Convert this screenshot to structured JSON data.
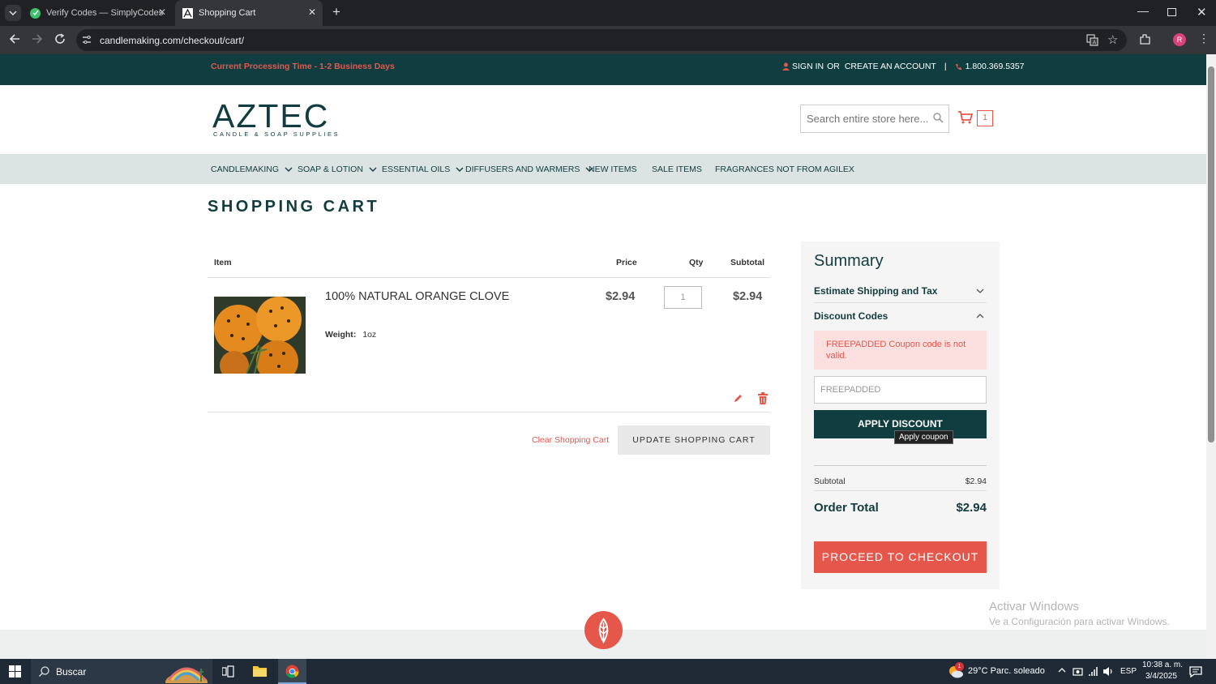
{
  "browser": {
    "tabs": [
      {
        "title": "Verify Codes — SimplyCodes",
        "active": false
      },
      {
        "title": "Shopping Cart",
        "active": true
      }
    ],
    "url": "candlemaking.com/checkout/cart/",
    "profile_initial": "R"
  },
  "site": {
    "processing_notice": "Current Processing Time - 1-2 Business Days",
    "sign_in": "SIGN IN",
    "or": "OR",
    "create_account": "CREATE AN ACCOUNT",
    "separator": "|",
    "phone": "1.800.369.5357",
    "logo_main": "AZTEC",
    "logo_sub": "CANDLE & SOAP SUPPLIES",
    "search_placeholder": "Search entire store here...",
    "cart_count": "1",
    "nav": [
      {
        "label": "CANDLEMAKING",
        "dropdown": true
      },
      {
        "label": "SOAP & LOTION",
        "dropdown": true
      },
      {
        "label": "ESSENTIAL OILS",
        "dropdown": true
      },
      {
        "label": "DIFFUSERS AND WARMERS",
        "dropdown": true
      },
      {
        "label": "NEW ITEMS",
        "dropdown": false
      },
      {
        "label": "SALE ITEMS",
        "dropdown": false
      },
      {
        "label": "FRAGRANCES NOT FROM AGILEX",
        "dropdown": false
      }
    ],
    "colors": {
      "dark_teal": "#0f3d40",
      "accent_red": "#e5574b",
      "nav_bg": "#dbe4e3"
    }
  },
  "cart": {
    "title": "SHOPPING CART",
    "headers": {
      "item": "Item",
      "price": "Price",
      "qty": "Qty",
      "subtotal": "Subtotal"
    },
    "items": [
      {
        "name": "100% NATURAL ORANGE CLOVE",
        "price": "$2.94",
        "qty": "1",
        "subtotal": "$2.94",
        "option_label": "Weight",
        "option_value": "1oz"
      }
    ],
    "clear_label": "Clear Shopping Cart",
    "update_label": "UPDATE SHOPPING CART"
  },
  "summary": {
    "title": "Summary",
    "shipping_label": "Estimate Shipping and Tax",
    "discount_label": "Discount Codes",
    "error_message": "FREEPADDED Coupon code is not valid.",
    "coupon_value": "FREEPADDED",
    "apply_label": "APPLY DISCOUNT",
    "tooltip": "Apply coupon",
    "subtotal_label": "Subtotal",
    "subtotal_value": "$2.94",
    "order_total_label": "Order Total",
    "order_total_value": "$2.94",
    "checkout_label": "PROCEED TO CHECKOUT"
  },
  "watermark": {
    "line1": "Activar Windows",
    "line2": "Ve a Configuración para activar Windows."
  },
  "taskbar": {
    "search": "Buscar",
    "weather": "29°C  Parc. soleado",
    "weather_badge": "1",
    "lang": "ESP",
    "time": "10:38 a. m.",
    "date": "3/4/2025"
  }
}
